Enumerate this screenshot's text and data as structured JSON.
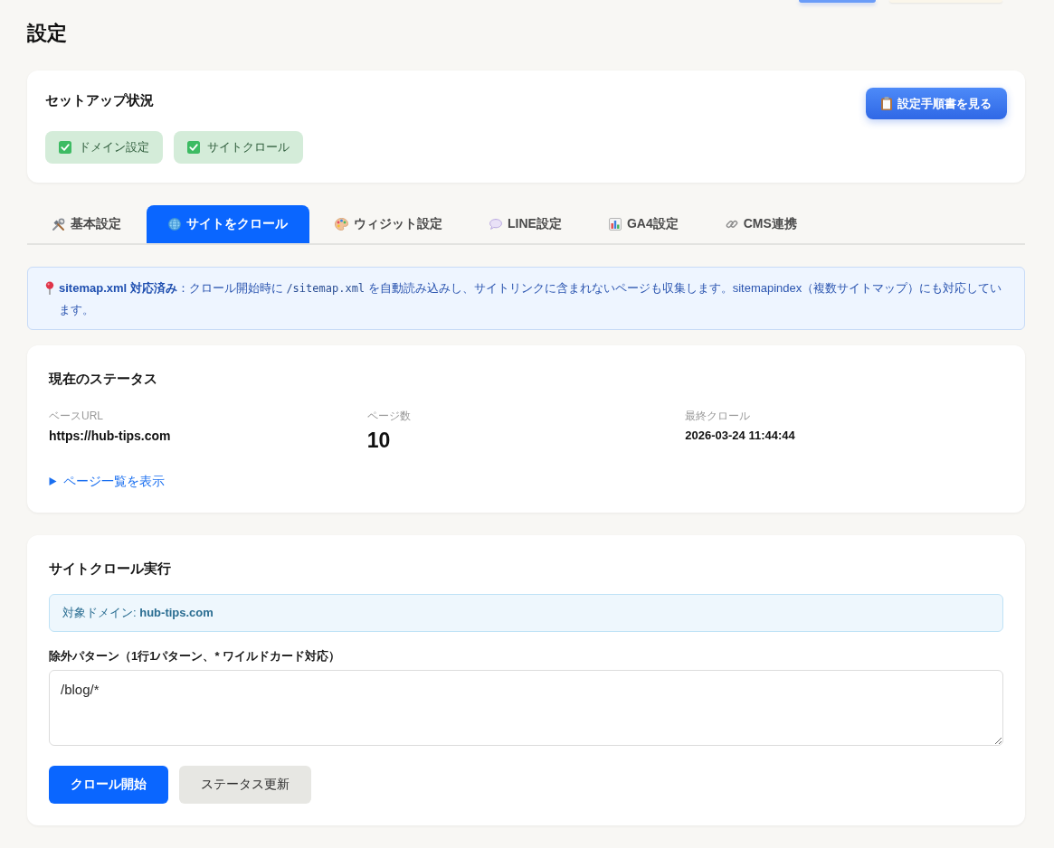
{
  "page": {
    "title": "設定"
  },
  "setup": {
    "title": "セットアップ状況",
    "guide_button": "設定手順書を見る",
    "badges": [
      {
        "label": "ドメイン設定",
        "checked": true
      },
      {
        "label": "サイトクロール",
        "checked": true
      }
    ]
  },
  "tabs": [
    {
      "label": "基本設定",
      "selected": false
    },
    {
      "label": "サイトをクロール",
      "selected": true
    },
    {
      "label": "ウィジット設定",
      "selected": false
    },
    {
      "label": "LINE設定",
      "selected": false
    },
    {
      "label": "GA4設定",
      "selected": false
    },
    {
      "label": "CMS連携",
      "selected": false
    }
  ],
  "notice": {
    "segments": [
      {
        "kind": "strong",
        "text": "sitemap.xml 対応済み"
      },
      {
        "kind": "plain",
        "text": "：クロール開始時に "
      },
      {
        "kind": "code",
        "text": "/sitemap.xml"
      },
      {
        "kind": "plain",
        "text": " を自動読み込みし、サイトリンクに含まれないページも収集します。sitemapindex（複数サイトマップ）にも対応しています。"
      }
    ]
  },
  "status": {
    "title": "現在のステータス",
    "fields": [
      {
        "kind": "text",
        "label": "ベースURL",
        "value": "https://hub-tips.com"
      },
      {
        "kind": "count",
        "label": "ページ数",
        "value": "10"
      },
      {
        "kind": "time",
        "label": "最終クロール",
        "value": "2026-03-24 11:44:44"
      }
    ],
    "toggle": {
      "label": "ページ一覧を表示",
      "expanded": false
    }
  },
  "crawl": {
    "title": "サイトクロール実行",
    "domain": "対象ドメイン: **hub-tips.com**",
    "exclude": {
      "label": "除外パターン（1行1パターン、* ワイルドカード対応）",
      "value": "/blog/*"
    },
    "buttons": [
      {
        "kind": "primary",
        "label": "クロール開始"
      },
      {
        "kind": "secondary",
        "label": "ステータス更新"
      }
    ]
  }
}
